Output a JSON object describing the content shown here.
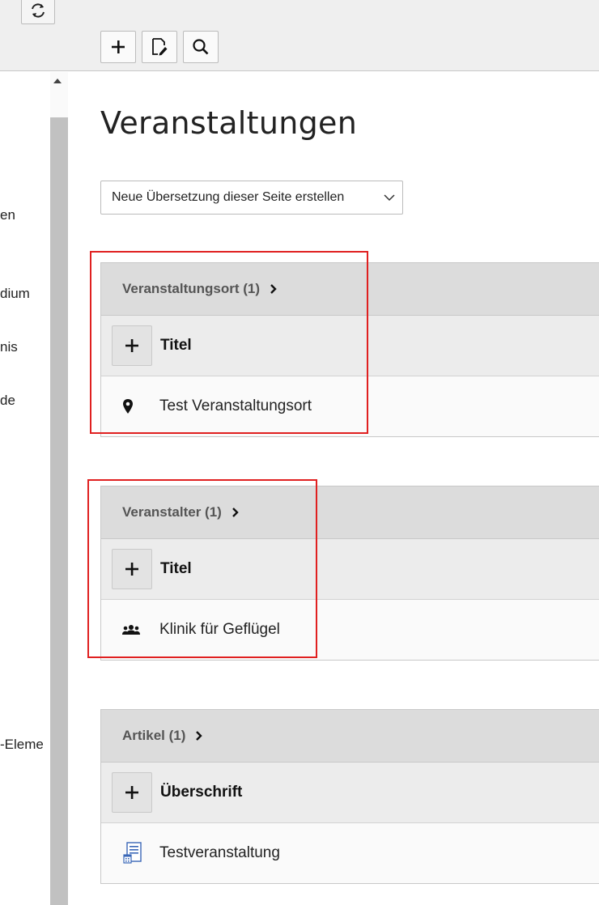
{
  "toolbar": {
    "refresh_icon": "refresh-icon",
    "buttons": [
      {
        "icon": "plus-icon"
      },
      {
        "icon": "edit-page-icon"
      },
      {
        "icon": "search-icon"
      }
    ]
  },
  "tree": {
    "items": [
      "en",
      "dium",
      "nis",
      "de",
      "-Eleme"
    ]
  },
  "page": {
    "title": "Veranstaltungen",
    "translation_select": "Neue Übersetzung dieser Seite erstellen"
  },
  "panels": [
    {
      "header": "Veranstaltungsort (1)",
      "column_title": "Titel",
      "record": {
        "label": "Test Veranstaltungsort",
        "icon": "map-marker-icon"
      }
    },
    {
      "header": "Veranstalter (1)",
      "column_title": "Titel",
      "record": {
        "label": "Klinik für Geflügel",
        "icon": "group-icon"
      }
    },
    {
      "header": "Artikel (1)",
      "column_title": "Überschrift",
      "record": {
        "label": "Testveranstaltung",
        "icon": "news-article-icon"
      }
    }
  ],
  "colors": {
    "highlight": "#e02020",
    "panel_header_bg": "#dcdcdc",
    "article_icon": "#3a67b7"
  }
}
